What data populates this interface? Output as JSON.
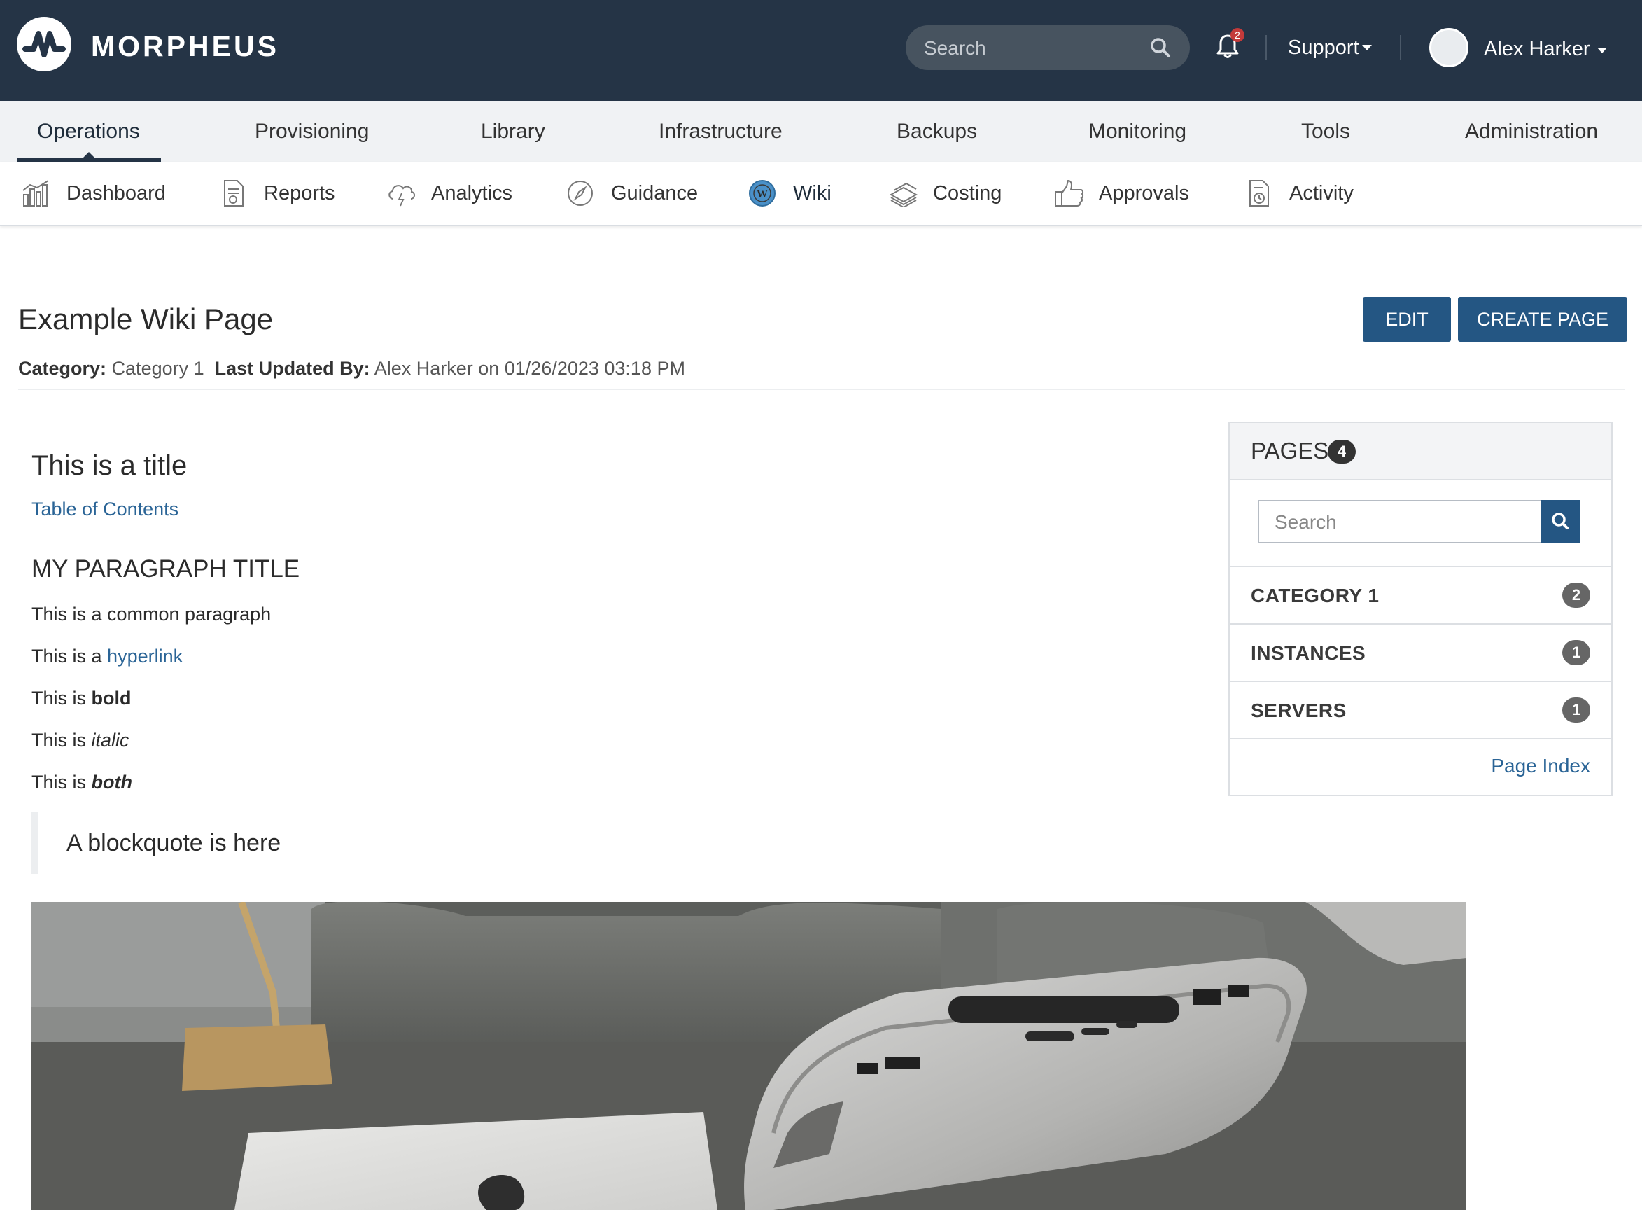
{
  "brand": {
    "name": "MORPHEUS"
  },
  "header": {
    "search_placeholder": "Search",
    "notification_count": "2",
    "support_label": "Support",
    "user_name": "Alex Harker"
  },
  "main_nav": {
    "items": [
      {
        "label": "Operations",
        "active": true
      },
      {
        "label": "Provisioning"
      },
      {
        "label": "Library"
      },
      {
        "label": "Infrastructure"
      },
      {
        "label": "Backups"
      },
      {
        "label": "Monitoring"
      },
      {
        "label": "Tools"
      },
      {
        "label": "Administration"
      }
    ]
  },
  "sub_nav": {
    "items": [
      {
        "label": "Dashboard",
        "icon": "bar-chart-icon"
      },
      {
        "label": "Reports",
        "icon": "report-document-icon"
      },
      {
        "label": "Analytics",
        "icon": "cloud-lightning-icon"
      },
      {
        "label": "Guidance",
        "icon": "compass-icon"
      },
      {
        "label": "Wiki",
        "icon": "wiki-icon",
        "active": true
      },
      {
        "label": "Costing",
        "icon": "money-stack-icon"
      },
      {
        "label": "Approvals",
        "icon": "thumbs-up-icon"
      },
      {
        "label": "Activity",
        "icon": "activity-document-icon"
      }
    ]
  },
  "page": {
    "title": "Example Wiki Page",
    "edit_label": "EDIT",
    "create_label": "CREATE PAGE",
    "category_label": "Category:",
    "category_value": "Category 1",
    "updated_label": "Last Updated By:",
    "updated_value": "Alex Harker on 01/26/2023 03:18 PM"
  },
  "content": {
    "title": "This is a title",
    "toc_link": "Table of Contents",
    "paragraph_title": "MY PARAGRAPH TITLE",
    "common": "This is a common paragraph",
    "prefix": "This is a",
    "hyperlink": "hyperlink",
    "prefix_is": "This is",
    "bold": "bold",
    "italic": "italic",
    "both": "both",
    "blockquote": "A blockquote is here"
  },
  "pages_panel": {
    "title": "PAGES",
    "count": "4",
    "search_placeholder": "Search",
    "categories": [
      {
        "label": "CATEGORY 1",
        "count": "2"
      },
      {
        "label": "INSTANCES",
        "count": "1"
      },
      {
        "label": "SERVERS",
        "count": "1"
      }
    ],
    "page_index_label": "Page Index"
  },
  "colors": {
    "header_bg": "#253446",
    "primary_button": "#245683",
    "link": "#2a6496"
  }
}
